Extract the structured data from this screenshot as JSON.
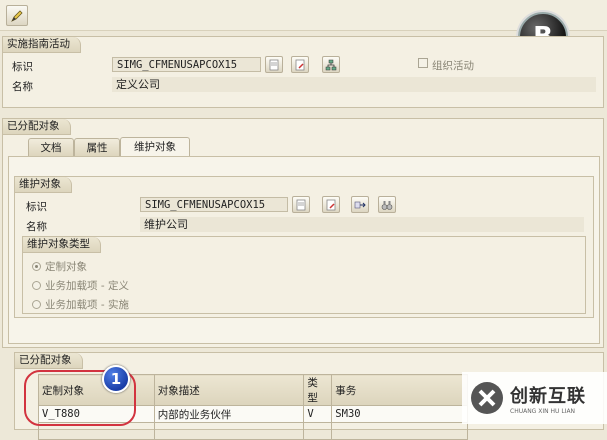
{
  "impl_activity": {
    "title": "实施指南活动",
    "id_label": "标识",
    "id_value": "SIMG_CFMENUSAPCOX15",
    "name_label": "名称",
    "name_value": "定义公司",
    "org_activity_label": "组织活动"
  },
  "assigned_objects": {
    "title": "已分配对象",
    "tabs": [
      {
        "label": "文档"
      },
      {
        "label": "属性"
      },
      {
        "label": "维护对象"
      }
    ]
  },
  "maint_object": {
    "title": "维护对象",
    "id_label": "标识",
    "id_value": "SIMG_CFMENUSAPCOX15",
    "name_label": "名称",
    "name_value": "维护公司",
    "type_group_title": "维护对象类型",
    "radios": [
      {
        "label": "定制对象",
        "selected": true
      },
      {
        "label": "业务加载项 - 定义",
        "selected": false
      },
      {
        "label": "业务加载项 - 实施",
        "selected": false
      }
    ]
  },
  "assigned_table": {
    "title": "已分配对象",
    "headers": [
      "定制对象",
      "对象描述",
      "类型",
      "事务"
    ],
    "row": [
      "V_T880",
      "内部的业务伙伴",
      "V",
      "SM30"
    ]
  },
  "badges": {
    "b": "B",
    "one": "1"
  },
  "watermark": {
    "cn": "创新互联",
    "en": "CHUANG XIN HU LIAN"
  }
}
